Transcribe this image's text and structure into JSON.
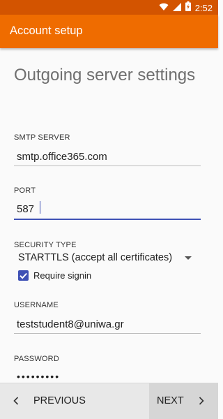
{
  "status_bar": {
    "time": "2:52",
    "icons": [
      "wifi-icon",
      "signal-icon",
      "battery-icon"
    ]
  },
  "app_bar": {
    "title": "Account setup"
  },
  "page": {
    "heading": "Outgoing server settings"
  },
  "smtp_server": {
    "label": "SMTP SERVER",
    "value": "smtp.office365.com"
  },
  "port": {
    "label": "PORT",
    "value": "587"
  },
  "security_type": {
    "label": "SECURITY TYPE",
    "selected": "STARTTLS (accept all certificates)"
  },
  "require_signin": {
    "label": "Require signin",
    "checked": true
  },
  "username": {
    "label": "USERNAME",
    "value": "teststudent8@uniwa.gr"
  },
  "password": {
    "label": "PASSWORD",
    "masked_value": "•••••••••"
  },
  "nav": {
    "previous_label": "PREVIOUS",
    "next_label": "NEXT"
  },
  "colors": {
    "app_bar": "#ef6c00",
    "status_bar": "#d35400",
    "accent": "#3f51b5"
  }
}
